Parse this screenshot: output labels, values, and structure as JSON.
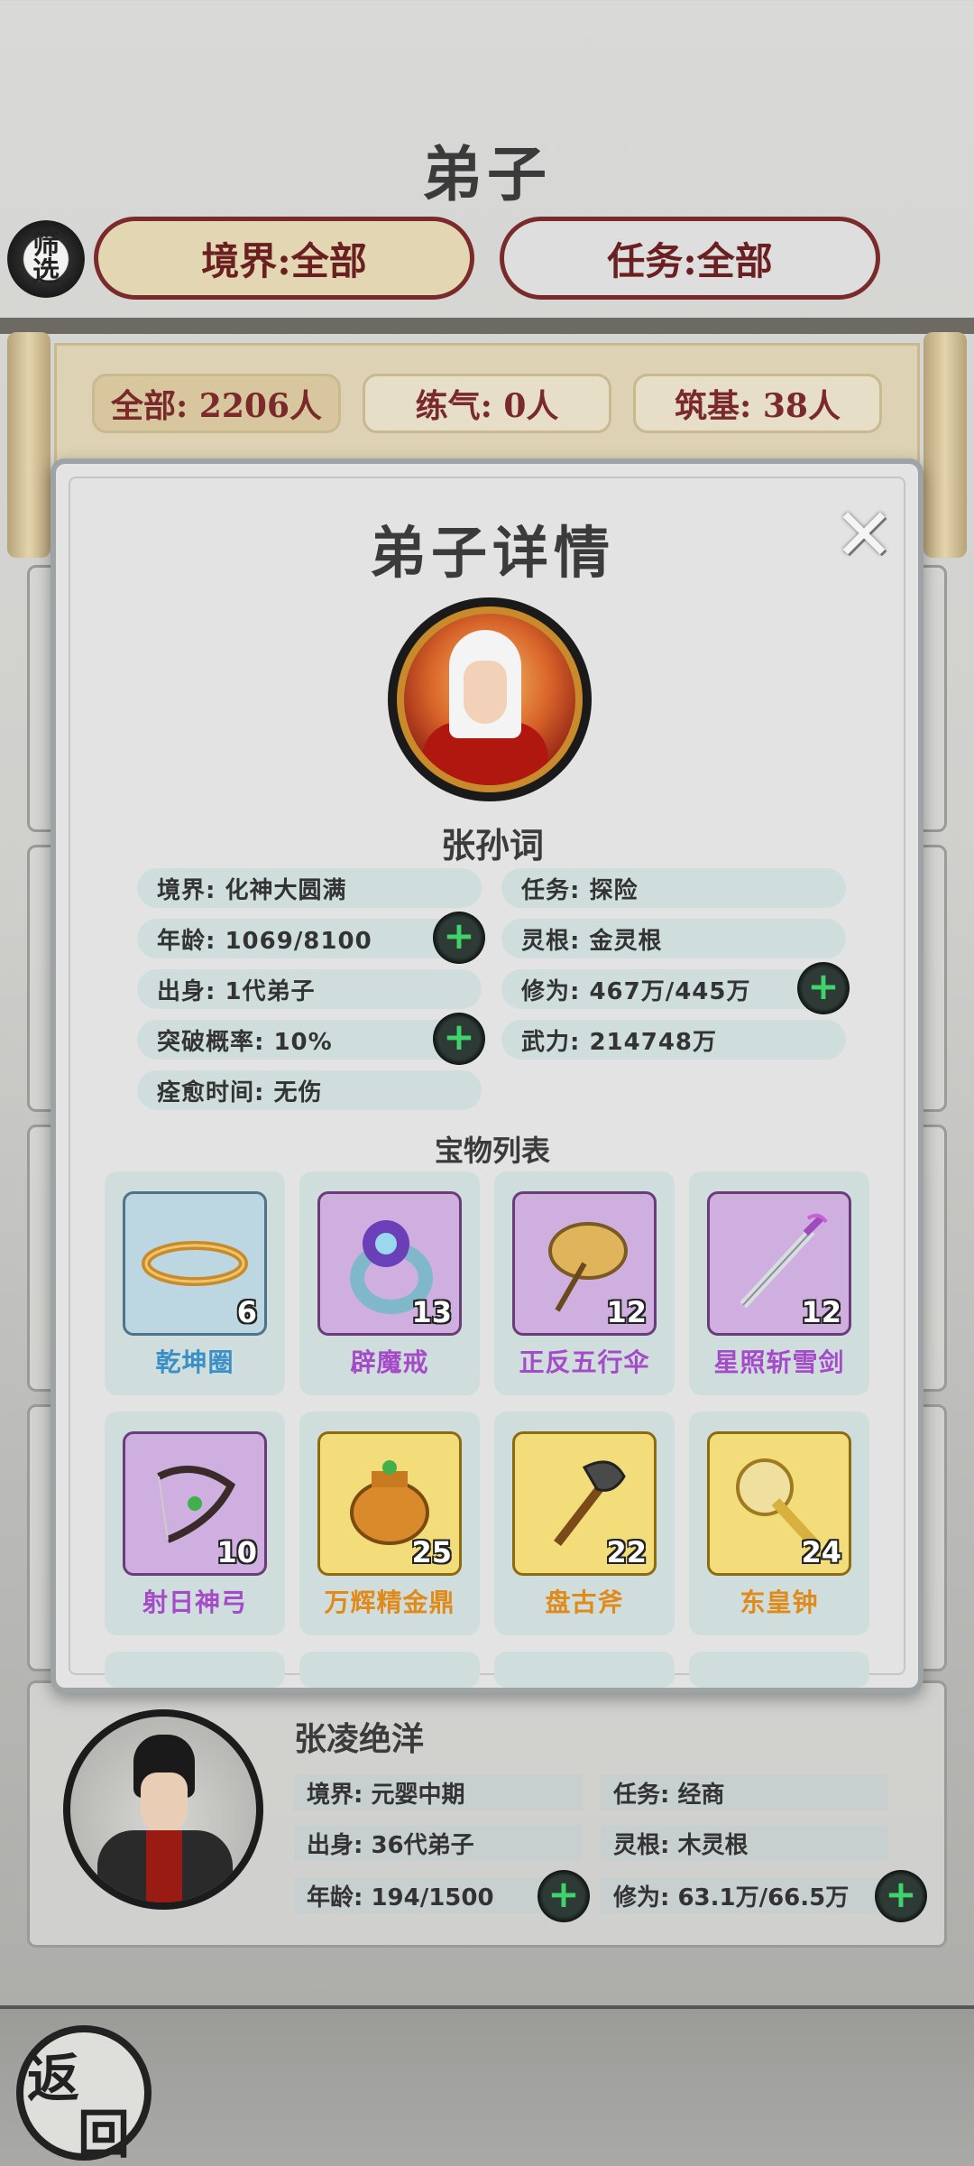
{
  "header": {
    "title": "弟子",
    "filter_label": "筛选",
    "realm_filter": "境界:全部",
    "task_filter": "任务:全部"
  },
  "counts": [
    {
      "label": "全部: 2206人"
    },
    {
      "label": "练气: 0人"
    },
    {
      "label": "筑基: 38人"
    }
  ],
  "modal": {
    "title": "弟子详情",
    "close_icon": "close-x-icon",
    "name": "张孙词",
    "stats": {
      "realm": "境界: 化神大圆满",
      "task": "任务: 探险",
      "age": "年龄: 1069/8100",
      "root": "灵根: 金灵根",
      "origin": "出身: 1代弟子",
      "cultivation": "修为: 467万/445万",
      "breakthrough": "突破概率: 10%",
      "power": "武力: 214748万",
      "heal_time": "痊愈时间: 无伤"
    },
    "treasure_heading": "宝物列表",
    "treasures": [
      {
        "name": "乾坤圈",
        "level": "6",
        "rarity": "blue"
      },
      {
        "name": "辟魔戒",
        "level": "13",
        "rarity": "purple"
      },
      {
        "name": "正反五行伞",
        "level": "12",
        "rarity": "purple"
      },
      {
        "name": "星照斩雪剑",
        "level": "12",
        "rarity": "purple"
      },
      {
        "name": "射日神弓",
        "level": "10",
        "rarity": "purple"
      },
      {
        "name": "万辉精金鼎",
        "level": "25",
        "rarity": "gold"
      },
      {
        "name": "盘古斧",
        "level": "22",
        "rarity": "gold"
      },
      {
        "name": "东皇钟",
        "level": "24",
        "rarity": "gold"
      }
    ],
    "plus_symbol": "+"
  },
  "card": {
    "name": "张凌绝洋",
    "realm": "境界: 元婴中期",
    "task": "任务: 经商",
    "origin": "出身: 36代弟子",
    "root": "灵根: 木灵根",
    "age": "年龄: 194/1500",
    "cultivation": "修为: 63.1万/66.5万"
  },
  "return_label_1": "返",
  "return_label_2": "回",
  "colors": {
    "accent_red": "#7a2a2a",
    "rarity_blue": "#3a8fc7",
    "rarity_purple": "#a54ac9",
    "rarity_gold": "#e08a1a",
    "plus_green": "#3fd46a"
  }
}
